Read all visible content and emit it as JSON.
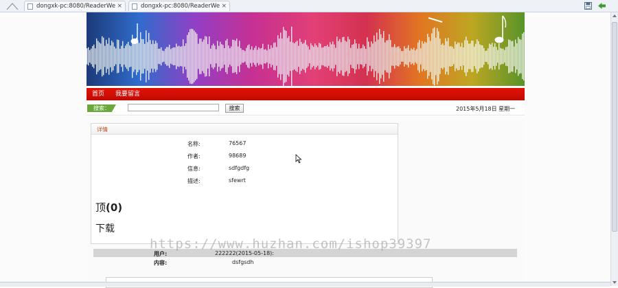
{
  "browser": {
    "tabs": [
      {
        "title": "dongxk-pc:8080/ReaderWe",
        "close": "×"
      },
      {
        "title": "dongxk-pc:8080/ReaderWe",
        "close": "×"
      }
    ]
  },
  "nav": {
    "items": [
      "首页",
      "我要留言"
    ]
  },
  "search": {
    "badge": "搜索：",
    "input_value": "",
    "button": "搜索",
    "date": "2015年5月18日 星期一"
  },
  "detail": {
    "header": "详情",
    "fields": [
      {
        "label": "名称:",
        "value": "76567"
      },
      {
        "label": "作者:",
        "value": "98689"
      },
      {
        "label": "信息:",
        "value": "sdfgdfg"
      },
      {
        "label": "描述:",
        "value": "sfewrt"
      }
    ],
    "top_label": "顶",
    "top_count": "(0)",
    "download": "下载"
  },
  "comment": {
    "user_label": "用户:",
    "user_value": "222222(2015-05-18):",
    "content_label": "内容:",
    "content_value": "dsfgsdh"
  },
  "watermark": "https://www.huzhan.com/ishop39397",
  "colors": {
    "nav_red": "#d80e05",
    "search_badge_green": "#6aa83a",
    "comment_bar_gray": "#d4d4d4"
  }
}
